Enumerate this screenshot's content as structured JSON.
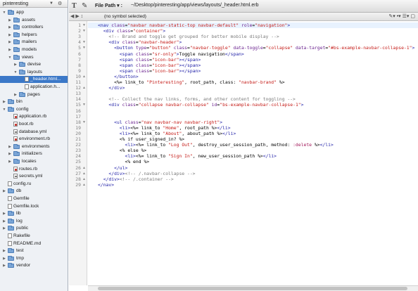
{
  "sidebar": {
    "project_name": "pinteresting",
    "tree": [
      {
        "label": "app",
        "kind": "folder",
        "level": 0,
        "open": true
      },
      {
        "label": "assets",
        "kind": "folder",
        "level": 1,
        "open": false
      },
      {
        "label": "controllers",
        "kind": "folder",
        "level": 1,
        "open": false
      },
      {
        "label": "helpers",
        "kind": "folder",
        "level": 1,
        "open": false
      },
      {
        "label": "mailers",
        "kind": "folder",
        "level": 1,
        "open": false
      },
      {
        "label": "models",
        "kind": "folder",
        "level": 1,
        "open": false
      },
      {
        "label": "views",
        "kind": "folder",
        "level": 1,
        "open": true
      },
      {
        "label": "devise",
        "kind": "folder",
        "level": 2,
        "open": false
      },
      {
        "label": "layouts",
        "kind": "folder",
        "level": 2,
        "open": true
      },
      {
        "label": "_header.html...",
        "kind": "file",
        "level": 3,
        "selected": true
      },
      {
        "label": "application.h...",
        "kind": "file",
        "level": 3
      },
      {
        "label": "pages",
        "kind": "folder",
        "level": 2,
        "open": false
      },
      {
        "label": "bin",
        "kind": "folder",
        "level": 0,
        "open": false
      },
      {
        "label": "config",
        "kind": "folder",
        "level": 0,
        "open": true
      },
      {
        "label": "application.rb",
        "kind": "rb",
        "level": 1
      },
      {
        "label": "boot.rb",
        "kind": "rb",
        "level": 1
      },
      {
        "label": "database.yml",
        "kind": "yml",
        "level": 1
      },
      {
        "label": "environment.rb",
        "kind": "rb",
        "level": 1
      },
      {
        "label": "environments",
        "kind": "folder",
        "level": 1,
        "open": false
      },
      {
        "label": "initializers",
        "kind": "folder",
        "level": 1,
        "open": false
      },
      {
        "label": "locales",
        "kind": "folder",
        "level": 1,
        "open": false
      },
      {
        "label": "routes.rb",
        "kind": "rb",
        "level": 1
      },
      {
        "label": "secrets.yml",
        "kind": "yml",
        "level": 1
      },
      {
        "label": "config.ru",
        "kind": "file",
        "level": 0
      },
      {
        "label": "db",
        "kind": "folder",
        "level": 0,
        "open": false
      },
      {
        "label": "Gemfile",
        "kind": "file",
        "level": 0
      },
      {
        "label": "Gemfile.lock",
        "kind": "file",
        "level": 0
      },
      {
        "label": "lib",
        "kind": "folder",
        "level": 0,
        "open": false
      },
      {
        "label": "log",
        "kind": "folder",
        "level": 0,
        "open": false
      },
      {
        "label": "public",
        "kind": "folder",
        "level": 0,
        "open": false
      },
      {
        "label": "Rakefile",
        "kind": "file",
        "level": 0
      },
      {
        "label": "README.md",
        "kind": "file",
        "level": 0
      },
      {
        "label": "test",
        "kind": "folder",
        "level": 0,
        "open": false
      },
      {
        "label": "tmp",
        "kind": "folder",
        "level": 0,
        "open": false
      },
      {
        "label": "vendor",
        "kind": "folder",
        "level": 0,
        "open": false
      }
    ]
  },
  "toolbar": {
    "file_path_label": "File Path ▾ :",
    "file_path_value": "~/Desktop/pinteresting/app/views/layouts/_header.html.erb"
  },
  "symbol_bar": {
    "selected_symbol": "(no symbol selected)"
  },
  "editor": {
    "current_line": 1,
    "lines": [
      "<nav class=\"navbar navbar-static-top navbar-default\" role=\"navigation\">",
      "  <div class=\"container\">",
      "    <!-- Brand and toggle get grouped for better mobile display -->",
      "    <div class=\"navbar-header\">",
      "      <button type=\"button\" class=\"navbar-toggle\" data-toggle=\"collapse\" data-target=\"#bs-example-navbar-collapse-1\">",
      "        <span class=\"sr-only\">Toggle navigation</span>",
      "        <span class=\"icon-bar\"></span>",
      "        <span class=\"icon-bar\"></span>",
      "        <span class=\"icon-bar\"></span>",
      "      </button>",
      "      <%= link_to \"Pinteresting\", root_path, class: \"navbar-brand\" %>",
      "    </div>",
      "",
      "    <!-- Collect the nav links, forms, and other content for toggling -->",
      "    <div class=\"collapse navbar-collapse\" id=\"bs-example-navbar-collapse-1\">",
      "",
      "",
      "      <ul class=\"nav navbar-nav navbar-right\">",
      "        <li><%= link_to \"Home\", root_path %></li>",
      "        <li><%= link_to \"About\", about_path %></li>",
      "        <% if user_signed_in? %>",
      "          <li><%= link_to \"Log Out\", destroy_user_session_path, method: :delete %></li>",
      "        <% else %>",
      "          <li><%= link_to \"Sign In\", new_user_session_path %></li>",
      "          <% end %>",
      "      </ul>",
      "    </div><!-- /.navbar-collapse -->",
      "  </div><!-- /.container -->",
      "</nav>"
    ]
  }
}
